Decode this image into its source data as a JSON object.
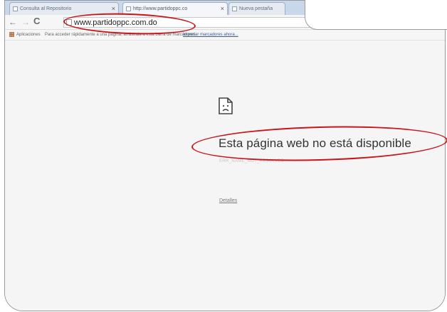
{
  "tabs": [
    {
      "label": "Consulta al Repositorio",
      "active": false
    },
    {
      "label": "http://www.partidoppc.co",
      "active": true
    },
    {
      "label": "Nueva pestaña",
      "active": false
    }
  ],
  "address_bar": {
    "url": "www.partidoppc.com.do"
  },
  "bookmarks_bar": {
    "apps_label": "Aplicaciones",
    "hint": "Para acceder rápidamente a una página, arrástrala a esta barra de marcadores.",
    "import_link": "Importar marcadores ahora..."
  },
  "error_page": {
    "icon": "sad-page-icon",
    "title": "Esta página web no está disponible",
    "code": "ERR_NAME_NOT_RESOLVED",
    "details_link": "Detalles"
  },
  "colors": {
    "annotation": "#c8151b"
  }
}
